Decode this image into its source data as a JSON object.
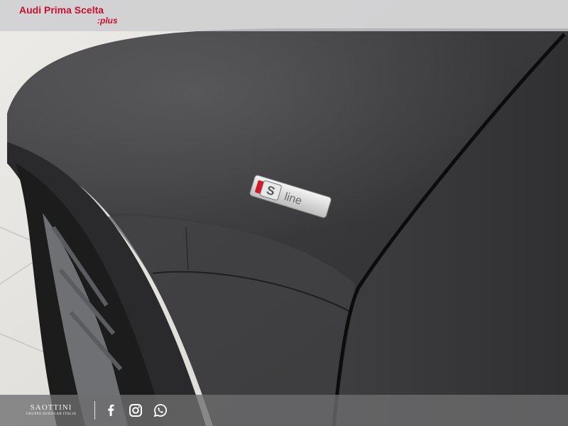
{
  "header": {
    "brand_audi": "Audi",
    "brand_rest": "Prima Scelta",
    "brand_suffix": ":plus"
  },
  "badge": {
    "text": "line",
    "letter": "S"
  },
  "footer": {
    "dealer_name": "SAOTTINI",
    "dealer_group": "GRUPPO EUROCAR ITALIA",
    "social": [
      "facebook-icon",
      "instagram-icon",
      "whatsapp-icon"
    ]
  },
  "colors": {
    "brand_red": "#c8102e",
    "car_body": "#3b3b3d",
    "floor": "#e2e0dc"
  }
}
